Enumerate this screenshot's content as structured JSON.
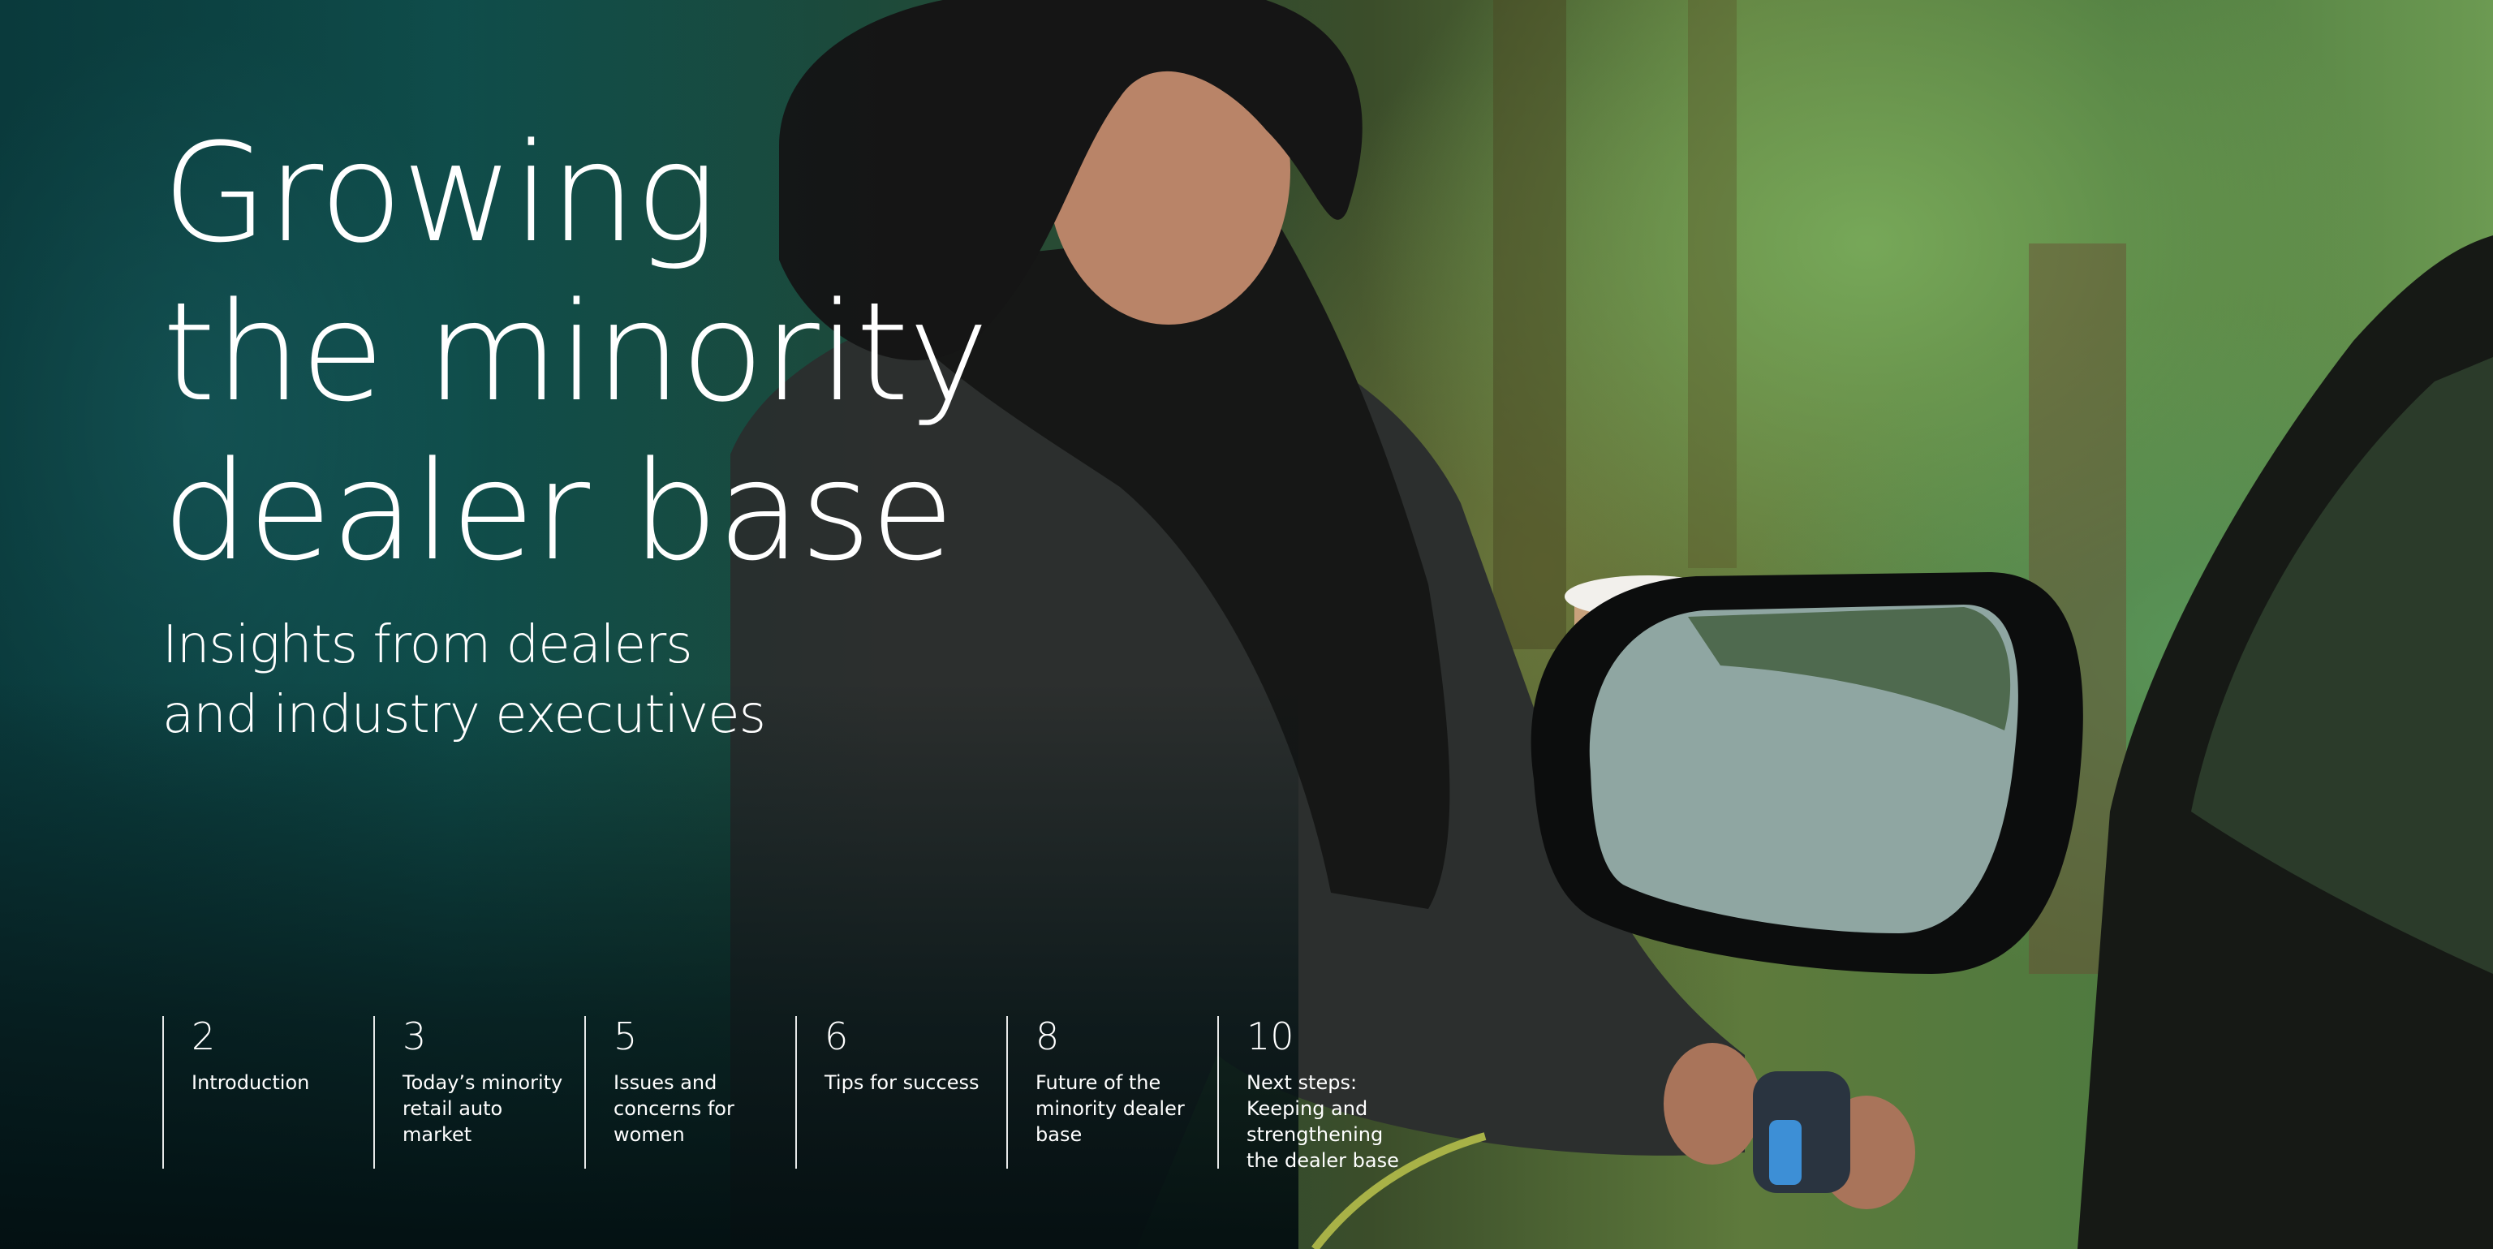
{
  "cover": {
    "title_lines": [
      "Growing",
      "the minority",
      "dealer base"
    ],
    "subtitle_lines": [
      "Insights from dealers",
      "and industry executives"
    ]
  },
  "toc": [
    {
      "page": "2",
      "label": "Introduction"
    },
    {
      "page": "3",
      "label": "Today’s minority retail auto market"
    },
    {
      "page": "5",
      "label": "Issues and concerns for women"
    },
    {
      "page": "6",
      "label": "Tips for success"
    },
    {
      "page": "8",
      "label": "Future of the minority dealer base"
    },
    {
      "page": "10",
      "label": "Next steps: Keeping and strengthening the dealer base"
    }
  ],
  "colors": {
    "text": "#ffffff",
    "foliage_left": "#135a55",
    "foliage_right": "#6c9a52"
  },
  "image": {
    "description_icon": "woman-charging-electric-car-photo"
  }
}
